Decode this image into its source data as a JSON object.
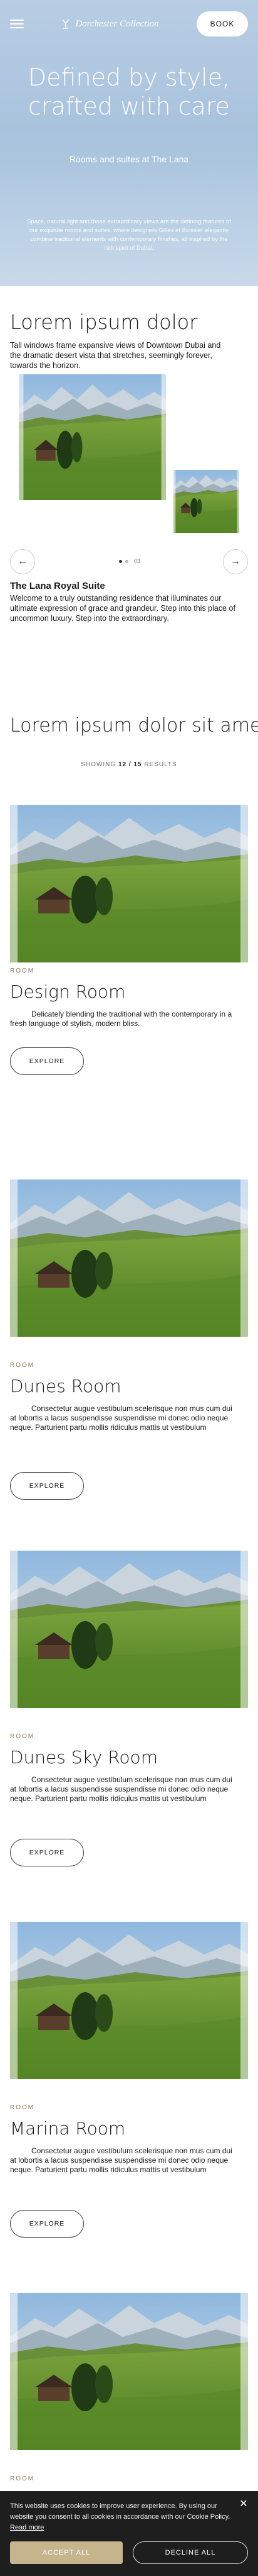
{
  "header": {
    "brand_name": "Dorchester Collection",
    "book_label": "BOOK"
  },
  "hero": {
    "title": "Defined by style, crafted with care",
    "subtitle": "Rooms and suites at The Lana",
    "description": "Space, natural light and those extraordinary views are the defining features of our exquisite rooms and suites, where designers Gilles et Boissier elegantly combine traditional elements with contemporary finishes, all inspired by the rich spirit of Dubai."
  },
  "intro": {
    "title": "Lorem ipsum dolor",
    "lead": "Tall windows frame expansive views of Downtown Dubai and the dramatic desert vista that stretches, seemingly forever, towards the horizon.",
    "counter": "03",
    "suite_title": "The Lana Royal Suite",
    "suite_desc": "Welcome to a truly outstanding residence that illuminates our ultimate expression of grace and grandeur. Step into this place of uncommon luxury. Step into the extraordinary."
  },
  "listing": {
    "title": "Lorem ipsum dolor sit amet",
    "showing_prefix": "SHOWING",
    "showing_count": "12 / 15",
    "showing_suffix": "RESULTS"
  },
  "rooms": [
    {
      "category": "ROOM",
      "name": "Design Room",
      "text": "Delicately blending the traditional with the contemporary in a fresh language of stylish, modern bliss.",
      "cta": "EXPLORE"
    },
    {
      "category": "ROOM",
      "name": "Dunes Room",
      "text": "Consectetur augue vestibulum scelerisque non mus cum dui at lobortis a lacus suspendisse suspendisse mi donec odio neque neque. Parturient partu mollis ridiculus mattis ut vestibulum",
      "cta": "EXPLORE"
    },
    {
      "category": "ROOM",
      "name": "Dunes Sky Room",
      "text": "Consectetur augue vestibulum scelerisque non mus cum dui at lobortis a lacus suspendisse suspendisse mi donec odio neque neque. Parturient partu mollis ridiculus mattis ut vestibulum",
      "cta": "EXPLORE"
    },
    {
      "category": "ROOM",
      "name": "Marina Room",
      "text": "Consectetur augue vestibulum scelerisque non mus cum dui at lobortis a lacus suspendisse suspendisse mi donec odio neque neque. Parturient partu mollis ridiculus mattis ut vestibulum",
      "cta": "EXPLORE"
    },
    {
      "category": "ROOM",
      "name": "",
      "text": "",
      "cta": ""
    }
  ],
  "cookie": {
    "message": "This website uses cookies to improve user experience. By using our website you consent to all cookies in accordance with our Cookie Policy.",
    "read_more": "Read more",
    "accept_label": "ACCEPT ALL",
    "decline_label": "DECLINE ALL"
  },
  "colors": {
    "hero_sky": "#a9c3de",
    "accent_gold": "#c6b58c",
    "category_text": "#8a7a55",
    "cookie_bg": "#1e1e1e"
  }
}
